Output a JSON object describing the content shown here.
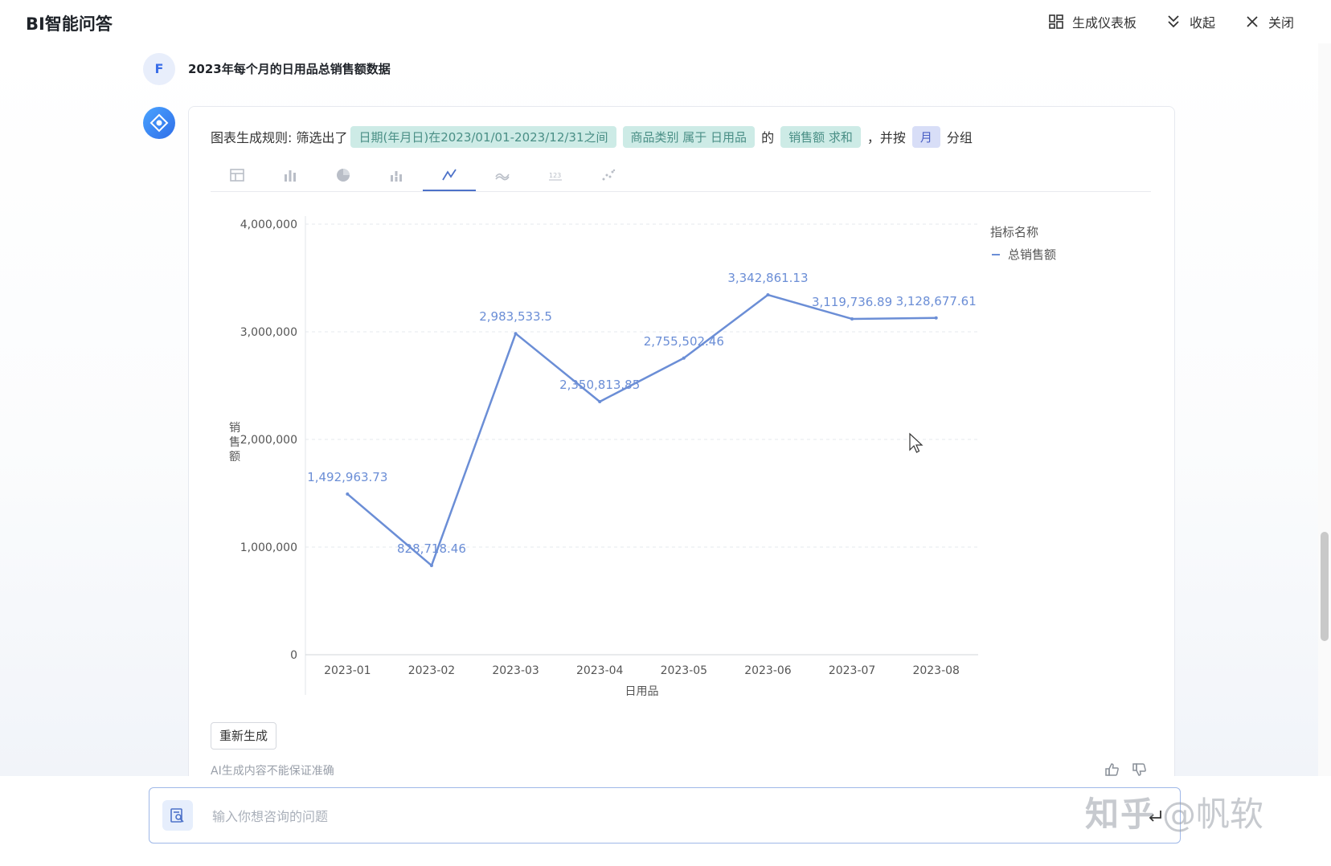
{
  "header": {
    "title": "BI智能问答",
    "generate_dashboard": "生成仪表板",
    "collapse": "收起",
    "close": "关闭"
  },
  "user": {
    "avatar_letter": "F",
    "question": "2023年每个月的日用品总销售额数据"
  },
  "rule": {
    "prefix": "图表生成规则: 筛选出了",
    "tag_date": "日期(年月日)在2023/01/01-2023/12/31之间",
    "tag_category": "商品类别 属于 日用品",
    "of": "的",
    "tag_metric": "销售额 求和",
    "and_by": "，并按",
    "tag_month": "月",
    "group": "分组"
  },
  "chart_types": [
    "table-icon",
    "bar-chart-icon",
    "pie-chart-icon",
    "stacked-bar-icon",
    "line-chart-icon",
    "area-chart-icon",
    "number-card-icon",
    "scatter-icon"
  ],
  "active_chart_type": "line-chart-icon",
  "chart_data": {
    "type": "line",
    "x": [
      "2023-01",
      "2023-02",
      "2023-03",
      "2023-04",
      "2023-05",
      "2023-06",
      "2023-07",
      "2023-08"
    ],
    "series": [
      {
        "name": "总销售额",
        "values": [
          1492963.73,
          828718.46,
          2983533.5,
          2350813.85,
          2755502.46,
          3342861.13,
          3119736.89,
          3128677.61
        ],
        "labels": [
          "1,492,963.73",
          "828,718.46",
          "2,983,533.5",
          "2,350,813.85",
          "2,755,502.46",
          "3,342,861.13",
          "3,119,736.89",
          "3,128,677.61"
        ]
      }
    ],
    "yticks": [
      0,
      1000000,
      2000000,
      3000000,
      4000000
    ],
    "ytick_labels": [
      "0",
      "1,000,000",
      "2,000,000",
      "3,000,000",
      "4,000,000"
    ],
    "ylim": [
      0,
      4000000
    ],
    "xlabel": "日用品",
    "ylabel": "销售额",
    "legend_title": "指标名称",
    "legend_position": "top-right",
    "color": "#6b8ed6",
    "grid": true
  },
  "footer": {
    "regenerate": "重新生成",
    "disclaimer": "AI生成内容不能保证准确"
  },
  "input": {
    "placeholder": "输入你想咨询的问题"
  },
  "watermark": {
    "logo": "知乎",
    "handle": "@帆软"
  }
}
